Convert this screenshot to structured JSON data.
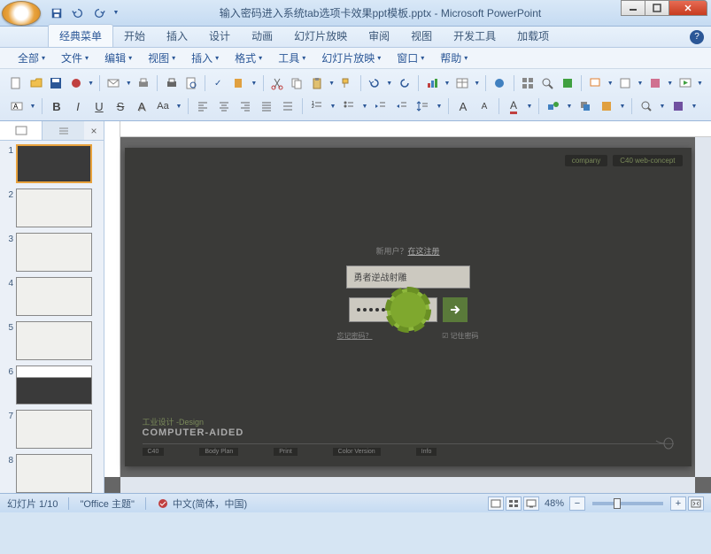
{
  "window": {
    "title": "输入密码进入系统tab选项卡效果ppt模板.pptx - Microsoft PowerPoint"
  },
  "ribbon_tabs": [
    "经典菜单",
    "开始",
    "插入",
    "设计",
    "动画",
    "幻灯片放映",
    "审阅",
    "视图",
    "开发工具",
    "加载项"
  ],
  "active_tab": 0,
  "menu": [
    "全部",
    "文件",
    "编辑",
    "视图",
    "插入",
    "格式",
    "工具",
    "幻灯片放映",
    "窗口",
    "帮助"
  ],
  "thumbnails": {
    "tabs": [
      "",
      ""
    ],
    "count": 8,
    "selected": 1
  },
  "slide": {
    "header_boxes": [
      "company",
      "C40 web-concept"
    ],
    "hint_prefix": "新用户？",
    "hint_link": "在这注册",
    "username_value": "勇者逆战射雕",
    "forgot": "忘记密码？",
    "remember": "记住密码",
    "footer_title": "工业设计 -Design",
    "footer_sub": "COMPUTER-AIDED",
    "footer_items": [
      "C40",
      "Body Plan",
      "Print",
      "Color Version",
      "Info"
    ]
  },
  "status": {
    "slide_indicator": "幻灯片 1/10",
    "theme": "\"Office 主题\"",
    "language": "中文(简体，中国)",
    "zoom": "48%"
  }
}
